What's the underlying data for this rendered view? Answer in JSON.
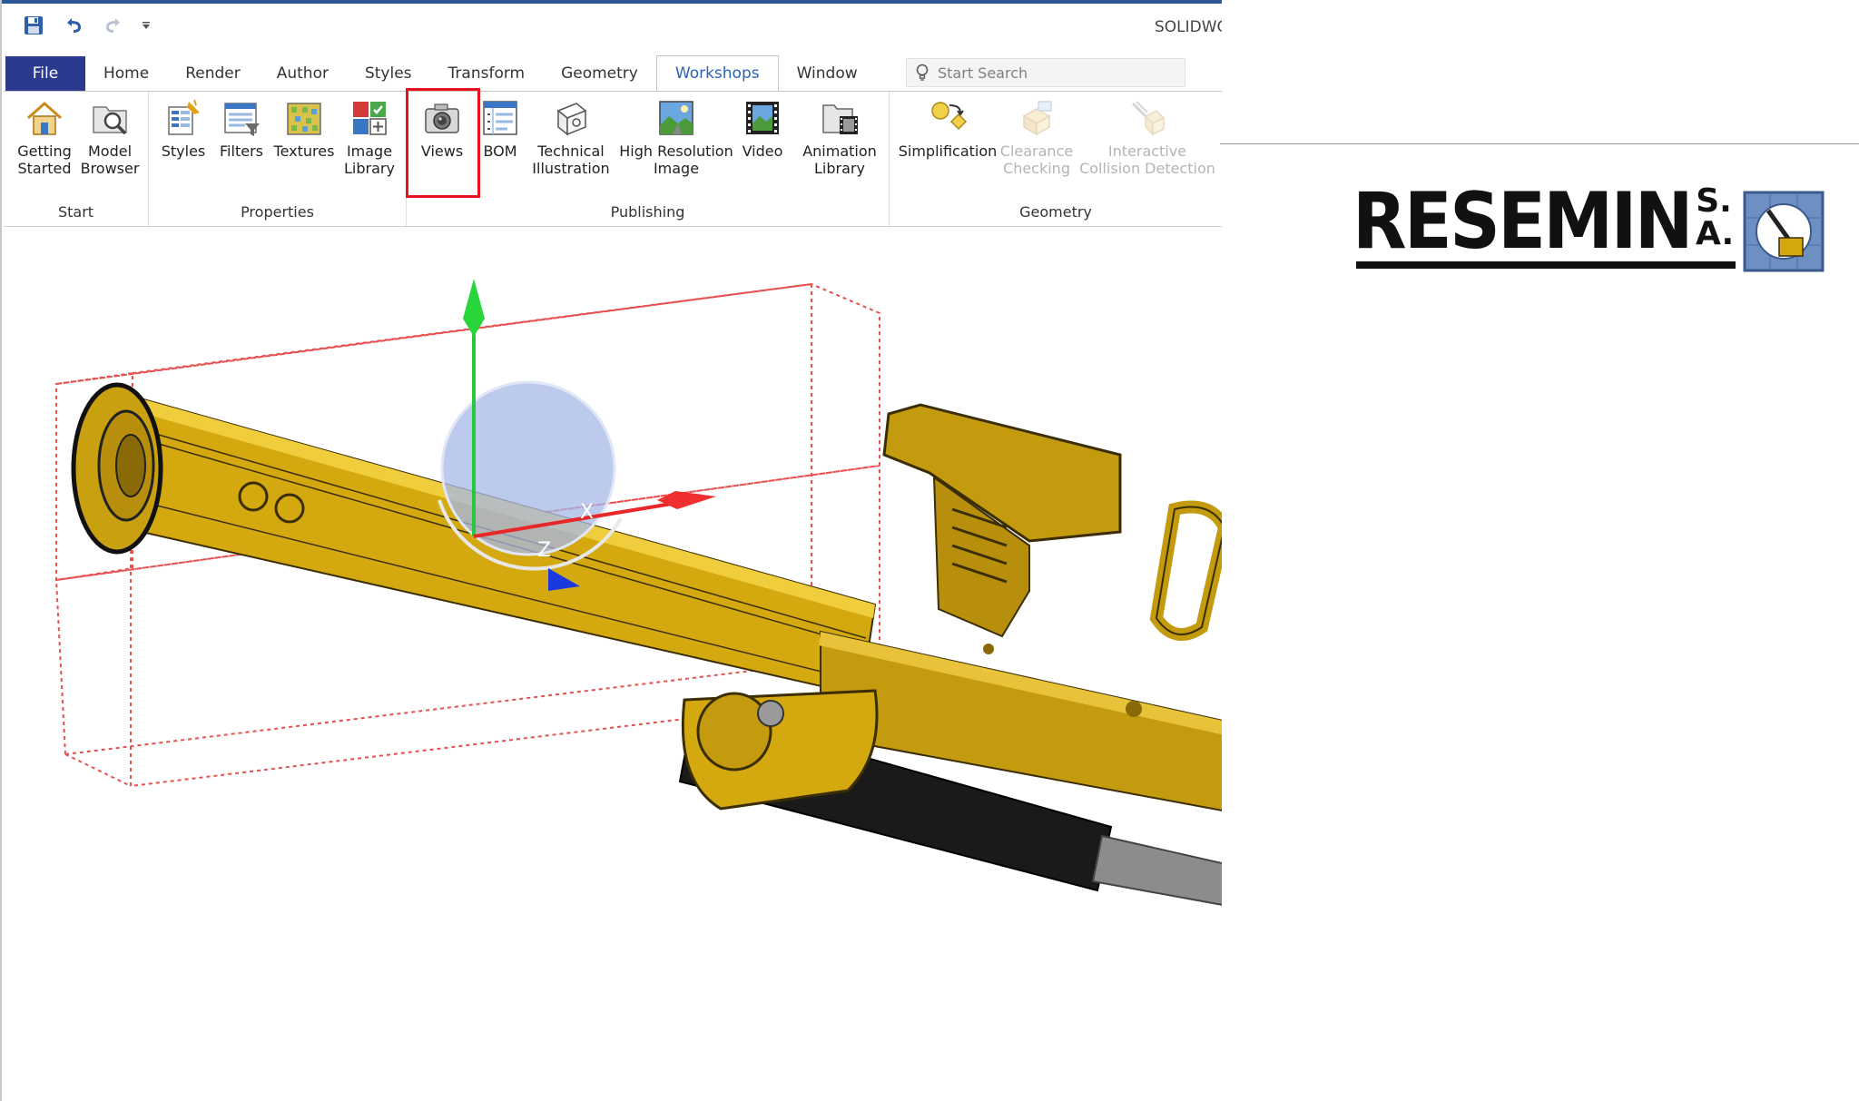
{
  "app": {
    "title": "SOLIDWORKS"
  },
  "quick_access": {
    "save_icon": "save-icon",
    "undo_icon": "undo-icon",
    "redo_icon": "redo-icon",
    "customize_icon": "chevron-down-icon"
  },
  "tabs": [
    {
      "label": "File",
      "kind": "file"
    },
    {
      "label": "Home"
    },
    {
      "label": "Render"
    },
    {
      "label": "Author"
    },
    {
      "label": "Styles"
    },
    {
      "label": "Transform"
    },
    {
      "label": "Geometry"
    },
    {
      "label": "Workshops",
      "active": true
    },
    {
      "label": "Window"
    }
  ],
  "search": {
    "placeholder": "Start Search"
  },
  "ribbon": {
    "groups": {
      "start": {
        "label": "Start",
        "buttons": [
          {
            "label": "Getting\nStarted",
            "icon": "home-icon"
          },
          {
            "label": "Model\nBrowser",
            "icon": "model-browser-icon"
          }
        ]
      },
      "properties": {
        "label": "Properties",
        "buttons": [
          {
            "label": "Styles",
            "icon": "styles-icon"
          },
          {
            "label": "Filters",
            "icon": "filters-icon"
          },
          {
            "label": "Textures",
            "icon": "textures-icon"
          },
          {
            "label": "Image\nLibrary",
            "icon": "image-library-icon"
          }
        ]
      },
      "publishing": {
        "label": "Publishing",
        "buttons": [
          {
            "label": "Views",
            "icon": "camera-icon"
          },
          {
            "label": "BOM",
            "icon": "bom-icon"
          },
          {
            "label": "Technical\nIllustration",
            "icon": "technical-illustration-icon"
          },
          {
            "label": "High Resolution\nImage",
            "icon": "high-resolution-image-icon"
          },
          {
            "label": "Video",
            "icon": "video-icon"
          },
          {
            "label": "Animation\nLibrary",
            "icon": "animation-library-icon"
          }
        ]
      },
      "geometry": {
        "label": "Geometry",
        "buttons": [
          {
            "label": "Simplification",
            "icon": "simplification-icon"
          },
          {
            "label": "Clearance\nChecking",
            "icon": "clearance-checking-icon",
            "disabled": true
          },
          {
            "label": "Interactive\nCollision Detection",
            "icon": "collision-detection-icon",
            "disabled": true
          }
        ]
      }
    }
  },
  "viewport": {
    "gizmo_axes": {
      "x": "X",
      "z": "Z"
    }
  },
  "logo": {
    "name": "RESEMIN",
    "suffix_top": "S.",
    "suffix_bottom": "A."
  },
  "colors": {
    "accent": "#2b5797",
    "file_tab": "#2b3a8f",
    "active_tab_text": "#2b63b6",
    "highlight": "#e8121d",
    "model_yellow": "#d4a90f",
    "bounding_box": "#e85050"
  }
}
